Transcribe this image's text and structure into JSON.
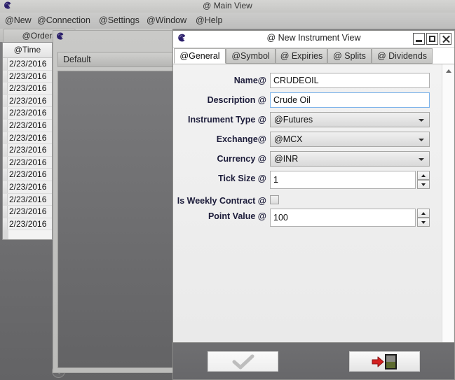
{
  "main_window": {
    "title": "@ Main View",
    "logo_icon": "spiral-logo-icon",
    "menu": [
      {
        "label": "@New"
      },
      {
        "label": "@Connection"
      },
      {
        "label": "@Settings"
      },
      {
        "label": "@Window"
      },
      {
        "label": "@Help"
      }
    ]
  },
  "orders_panel": {
    "tab_label": "@Orders",
    "grid": {
      "columns": [
        "@Time"
      ],
      "rows": [
        "2/23/2016",
        "2/23/2016",
        "2/23/2016",
        "2/23/2016",
        "2/23/2016",
        "2/23/2016",
        "2/23/2016",
        "2/23/2016",
        "2/23/2016",
        "2/23/2016",
        "2/23/2016",
        "2/23/2016",
        "2/23/2016",
        "2/23/2016"
      ]
    },
    "collapse_button_icon": "chevron-down-icon"
  },
  "background_window": {
    "logo_icon": "spiral-logo-icon",
    "tab_label": "Default"
  },
  "dialog": {
    "title": "@ New Instrument View",
    "logo_icon": "spiral-logo-icon",
    "window_controls": {
      "minimize": "minimize-icon",
      "maximize": "maximize-icon",
      "close": "close-icon"
    },
    "tabs": [
      {
        "label": "@General",
        "active": true
      },
      {
        "label": "@Symbol",
        "active": false
      },
      {
        "label": "@ Expiries",
        "active": false
      },
      {
        "label": "@ Splits",
        "active": false
      },
      {
        "label": "@ Dividends",
        "active": false
      }
    ],
    "fields": {
      "name": {
        "label": "Name@",
        "value": "CRUDEOIL",
        "type": "text"
      },
      "description": {
        "label": "Description @",
        "value": "Crude Oil",
        "type": "text",
        "focused": true
      },
      "instrument_type": {
        "label": "Instrument Type @",
        "value": "@Futures",
        "type": "combo"
      },
      "exchange": {
        "label": "Exchange@",
        "value": "@MCX",
        "type": "combo"
      },
      "currency": {
        "label": "Currency @",
        "value": "@INR",
        "type": "combo"
      },
      "tick_size": {
        "label": "Tick Size @",
        "value": "1",
        "type": "spinner"
      },
      "is_weekly_contract": {
        "label": "Is Weekly Contract @",
        "value": "",
        "type": "checkbox",
        "checked": false
      },
      "point_value": {
        "label": "Point Value @",
        "value": "100",
        "type": "spinner"
      }
    },
    "scrollbar": {
      "up_icon": "scroll-up-arrow-icon",
      "down_icon": "scroll-down-arrow-icon"
    },
    "footer": {
      "ok_icon": "checkmark-icon",
      "exit_icon": "exit-door-icon"
    }
  },
  "colors": {
    "desktop_grey": "#7a7a7c",
    "titlebar_grey": "#cccccb",
    "label_navy": "#1c1c3a",
    "focus_blue": "#7eb4ea",
    "exit_red": "#cf2020",
    "logo_purple": "#2b1f6b"
  }
}
